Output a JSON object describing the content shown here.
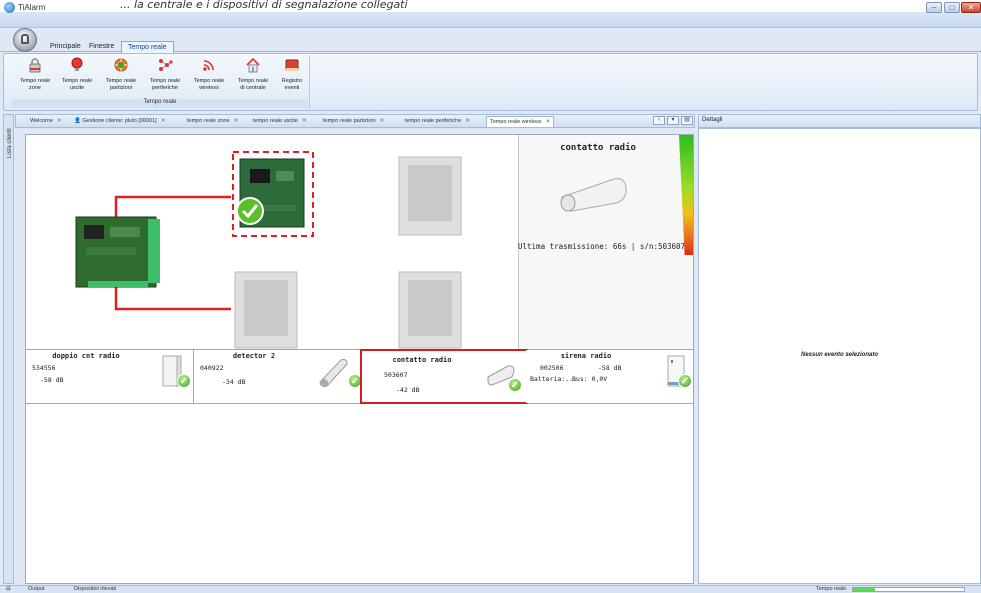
{
  "banner": {
    "text": "... la centrale e i dispositivi di segnalazione collegati"
  },
  "window": {
    "title": "TiAlarm",
    "controls": [
      "–",
      "□",
      "✕"
    ]
  },
  "ribbon": {
    "tabs": [
      {
        "label": "Principale",
        "active": false
      },
      {
        "label": "Finestre",
        "active": false
      },
      {
        "label": "Tempo reale",
        "active": true
      }
    ],
    "group_label": "Tempo reale",
    "buttons": [
      {
        "label": "Tempo reale zone",
        "icon": "lock-icon"
      },
      {
        "label": "Tempo reale uscite",
        "icon": "bulb-icon"
      },
      {
        "label": "Tempo reale partizioni",
        "icon": "partition-icon"
      },
      {
        "label": "Tempo reale periferiche",
        "icon": "network-icon"
      },
      {
        "label": "Tempo reale wireless",
        "icon": "wireless-icon"
      },
      {
        "label": "Tempo reale di centrale",
        "icon": "house-icon"
      },
      {
        "label": "Registro eventi",
        "icon": "book-icon"
      }
    ]
  },
  "client_strip": {
    "label": "Lista clienti"
  },
  "doc_tabs": [
    {
      "label": "Welcome",
      "active": false
    },
    {
      "label": "Gestione cliente: pluto [00001]",
      "active": false
    },
    {
      "label": "tempo reale zone",
      "active": false
    },
    {
      "label": "tempo reale uscite",
      "active": false
    },
    {
      "label": "tempo reale partizioni",
      "active": false
    },
    {
      "label": "tempo reale periferiche",
      "active": false
    },
    {
      "label": "Tempo reale wireless",
      "active": true
    }
  ],
  "details": {
    "title": "Dettagli",
    "empty_text": "Nessun evento selezionato"
  },
  "info_panel": {
    "title": "contatto radio",
    "transmission": "Ultima trasmissione: 66s | s/n:503607"
  },
  "cards": [
    {
      "title": "doppio cnt radio",
      "serial": "534556",
      "signal": "-58 dB",
      "selected": false
    },
    {
      "title": "detector 2",
      "serial": "040922",
      "signal": "-34 dB",
      "selected": false
    },
    {
      "title": "contatto radio",
      "serial": "503607",
      "signal": "-42 dB",
      "selected": true
    },
    {
      "title": "sirena radio",
      "serial": "002506",
      "signal": "-58 dB",
      "battery": "Batteria:...",
      "bus": "Bus: 0,0V",
      "selected": false
    }
  ],
  "statusbar": {
    "output": "Output",
    "devices": "Dispositivi rilevati",
    "realtime": "Tempo reale",
    "progress": 0.2
  },
  "colors": {
    "accent": "#d21e1e",
    "ok": "#39a51c",
    "ribbon": "#dfe9f6"
  }
}
